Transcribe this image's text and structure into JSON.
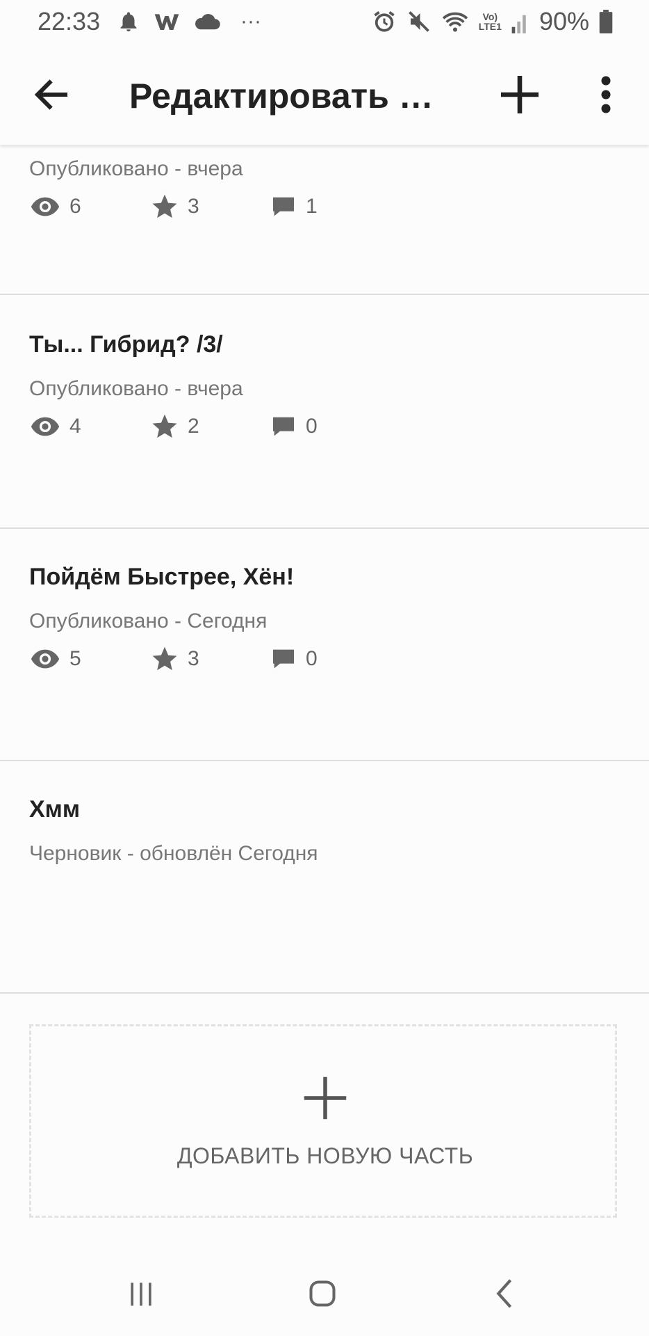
{
  "status_bar": {
    "time": "22:33",
    "battery": "90%",
    "network_top": "Vo)",
    "network_bottom": "LTE1",
    "more": "···",
    "icons": [
      "alarm-bell-icon",
      "w-app-icon",
      "cloud-icon",
      "alarm-clock-icon",
      "mute-icon",
      "wifi-icon",
      "signal-icon",
      "battery-icon"
    ]
  },
  "app_bar": {
    "title": "Редактировать и...",
    "icons": [
      "back-arrow-icon",
      "add-icon",
      "more-vert-icon"
    ]
  },
  "parts": [
    {
      "title": "",
      "status": "Опубликовано - вчера",
      "views": "6",
      "votes": "3",
      "comments": "1"
    },
    {
      "title": "Ты... Гибрид? /3/",
      "status": "Опубликовано - вчера",
      "views": "4",
      "votes": "2",
      "comments": "0"
    },
    {
      "title": "Пойдём Быстрее, Хён!",
      "status": "Опубликовано - Сегодня",
      "views": "5",
      "votes": "3",
      "comments": "0"
    },
    {
      "title": "Хмм",
      "status": "Черновик - обновлён Сегодня"
    }
  ],
  "add_part": {
    "label": "ДОБАВИТЬ НОВУЮ ЧАСТЬ",
    "icon": "plus-icon"
  },
  "nav_bar": {
    "icons": [
      "recent-apps-icon",
      "home-icon",
      "back-icon"
    ]
  },
  "colors": {
    "text_primary": "#222222",
    "text_secondary": "#777777",
    "icon_gray": "#666666",
    "divider": "#dedede",
    "background": "#fdfcfd"
  }
}
